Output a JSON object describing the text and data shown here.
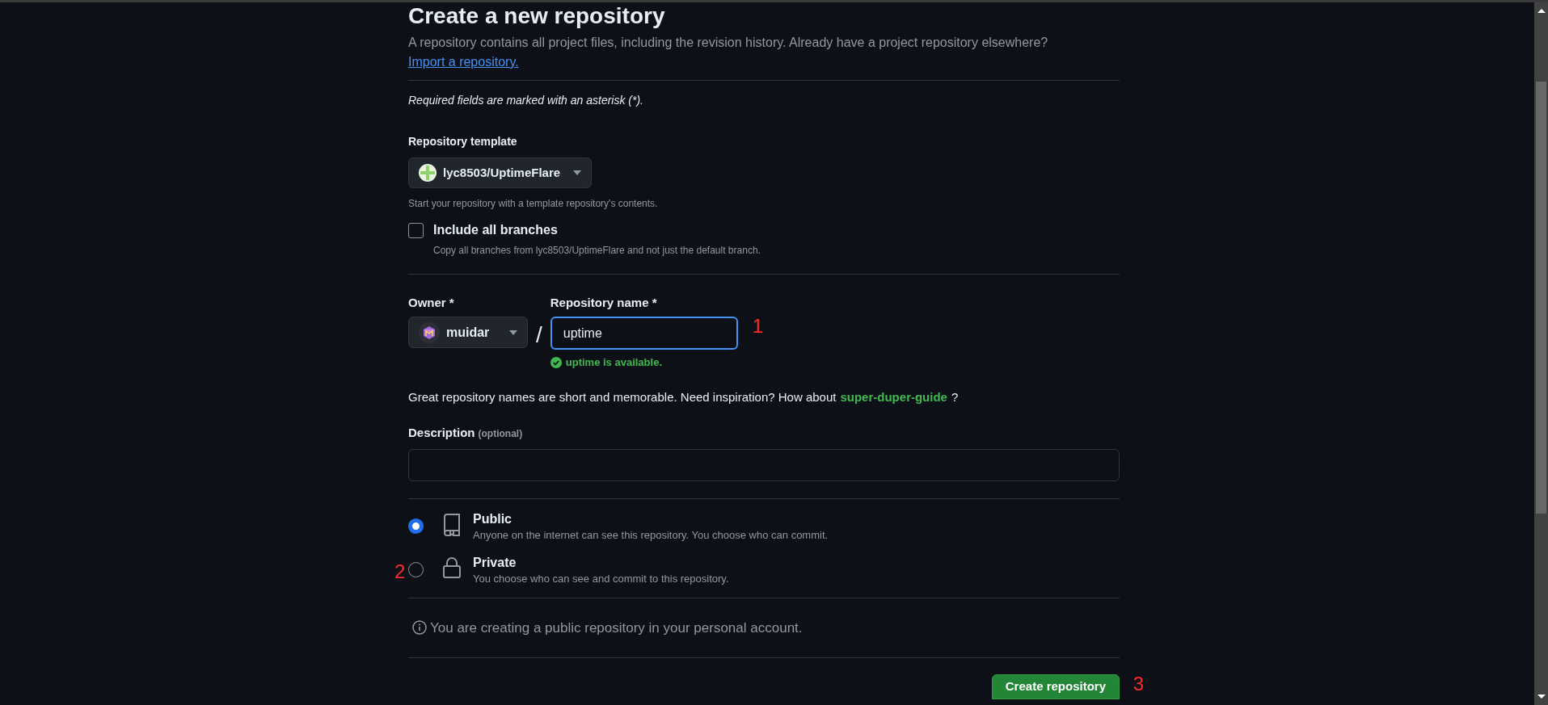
{
  "title": "Create a new repository",
  "intro": "A repository contains all project files, including the revision history. Already have a project repository elsewhere?",
  "import_link": "Import a repository.",
  "required_note": "Required fields are marked with an asterisk (*).",
  "template": {
    "label": "Repository template",
    "value": "lyc8503/UptimeFlare",
    "help": "Start your repository with a template repository's contents."
  },
  "include_branches": {
    "label": "Include all branches",
    "description": "Copy all branches from lyc8503/UptimeFlare and not just the default branch.",
    "checked": false
  },
  "owner": {
    "label": "Owner *",
    "value": "muidar"
  },
  "separator": "/",
  "repo_name": {
    "label": "Repository name *",
    "value": "uptime",
    "availability": "uptime is available."
  },
  "suggestion": {
    "text": "Great repository names are short and memorable. Need inspiration? How about",
    "link": "super-duper-guide",
    "suffix": "?"
  },
  "description": {
    "label": "Description",
    "hint": "(optional)"
  },
  "visibility": [
    {
      "kind": "book",
      "label": "Public",
      "description": "Anyone on the internet can see this repository. You choose who can commit.",
      "selected": true
    },
    {
      "kind": "lock",
      "label": "Private",
      "description": "You choose who can see and commit to this repository.",
      "selected": false
    }
  ],
  "info": "You are creating a public repository in your personal account.",
  "create_button": "Create repository",
  "annotations": [
    "1",
    "2",
    "3"
  ]
}
